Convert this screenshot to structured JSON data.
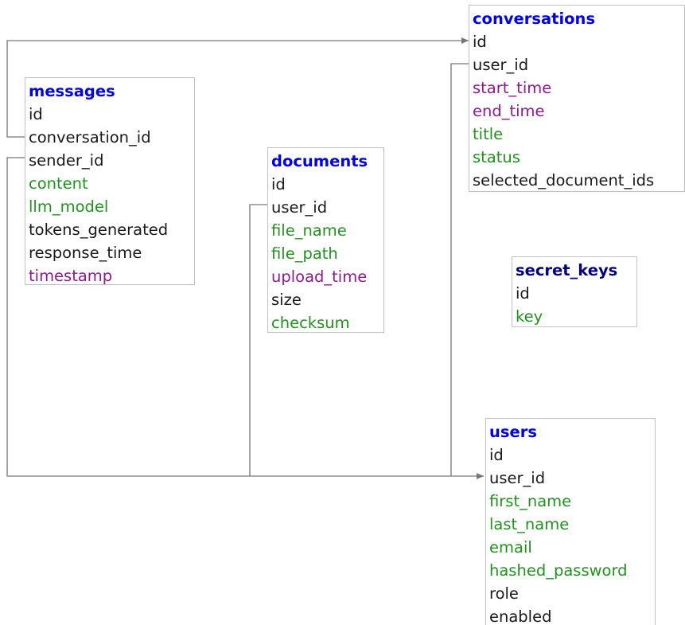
{
  "colors": {
    "title": "#0000ee",
    "title_dark": "#000080",
    "text": "#1a1a1a",
    "string": "#22911f",
    "datetime": "#8f1a8f",
    "border": "#c0c0c0",
    "link": "#777777"
  },
  "tables": [
    {
      "id": "messages",
      "title": "messages",
      "fields": [
        {
          "name": "id",
          "kind": "text"
        },
        {
          "name": "conversation_id",
          "kind": "text"
        },
        {
          "name": "sender_id",
          "kind": "text"
        },
        {
          "name": "content",
          "kind": "string"
        },
        {
          "name": "llm_model",
          "kind": "string"
        },
        {
          "name": "tokens_generated",
          "kind": "text"
        },
        {
          "name": "response_time",
          "kind": "text"
        },
        {
          "name": "timestamp",
          "kind": "datetime"
        }
      ]
    },
    {
      "id": "documents",
      "title": "documents",
      "fields": [
        {
          "name": "id",
          "kind": "text"
        },
        {
          "name": "user_id",
          "kind": "text"
        },
        {
          "name": "file_name",
          "kind": "string"
        },
        {
          "name": "file_path",
          "kind": "string"
        },
        {
          "name": "upload_time",
          "kind": "datetime"
        },
        {
          "name": "size",
          "kind": "text"
        },
        {
          "name": "checksum",
          "kind": "string"
        }
      ]
    },
    {
      "id": "conversations",
      "title": "conversations",
      "fields": [
        {
          "name": "id",
          "kind": "text"
        },
        {
          "name": "user_id",
          "kind": "text"
        },
        {
          "name": "start_time",
          "kind": "datetime"
        },
        {
          "name": "end_time",
          "kind": "datetime"
        },
        {
          "name": "title",
          "kind": "string"
        },
        {
          "name": "status",
          "kind": "string"
        },
        {
          "name": "selected_document_ids",
          "kind": "text"
        }
      ]
    },
    {
      "id": "secret_keys",
      "title": "secret_keys",
      "title_kind": "dark",
      "fields": [
        {
          "name": "id",
          "kind": "text"
        },
        {
          "name": "key",
          "kind": "string"
        }
      ]
    },
    {
      "id": "users",
      "title": "users",
      "fields": [
        {
          "name": "id",
          "kind": "text"
        },
        {
          "name": "user_id",
          "kind": "text"
        },
        {
          "name": "first_name",
          "kind": "string"
        },
        {
          "name": "last_name",
          "kind": "string"
        },
        {
          "name": "email",
          "kind": "string"
        },
        {
          "name": "hashed_password",
          "kind": "string"
        },
        {
          "name": "role",
          "kind": "text"
        },
        {
          "name": "enabled",
          "kind": "text"
        }
      ]
    }
  ],
  "relationships": [
    {
      "from": "messages.conversation_id",
      "to": "conversations.id"
    },
    {
      "from": "messages.sender_id",
      "to": "users.user_id"
    },
    {
      "from": "documents.user_id",
      "to": "users.user_id"
    },
    {
      "from": "conversations.user_id",
      "to": "users.user_id"
    }
  ]
}
